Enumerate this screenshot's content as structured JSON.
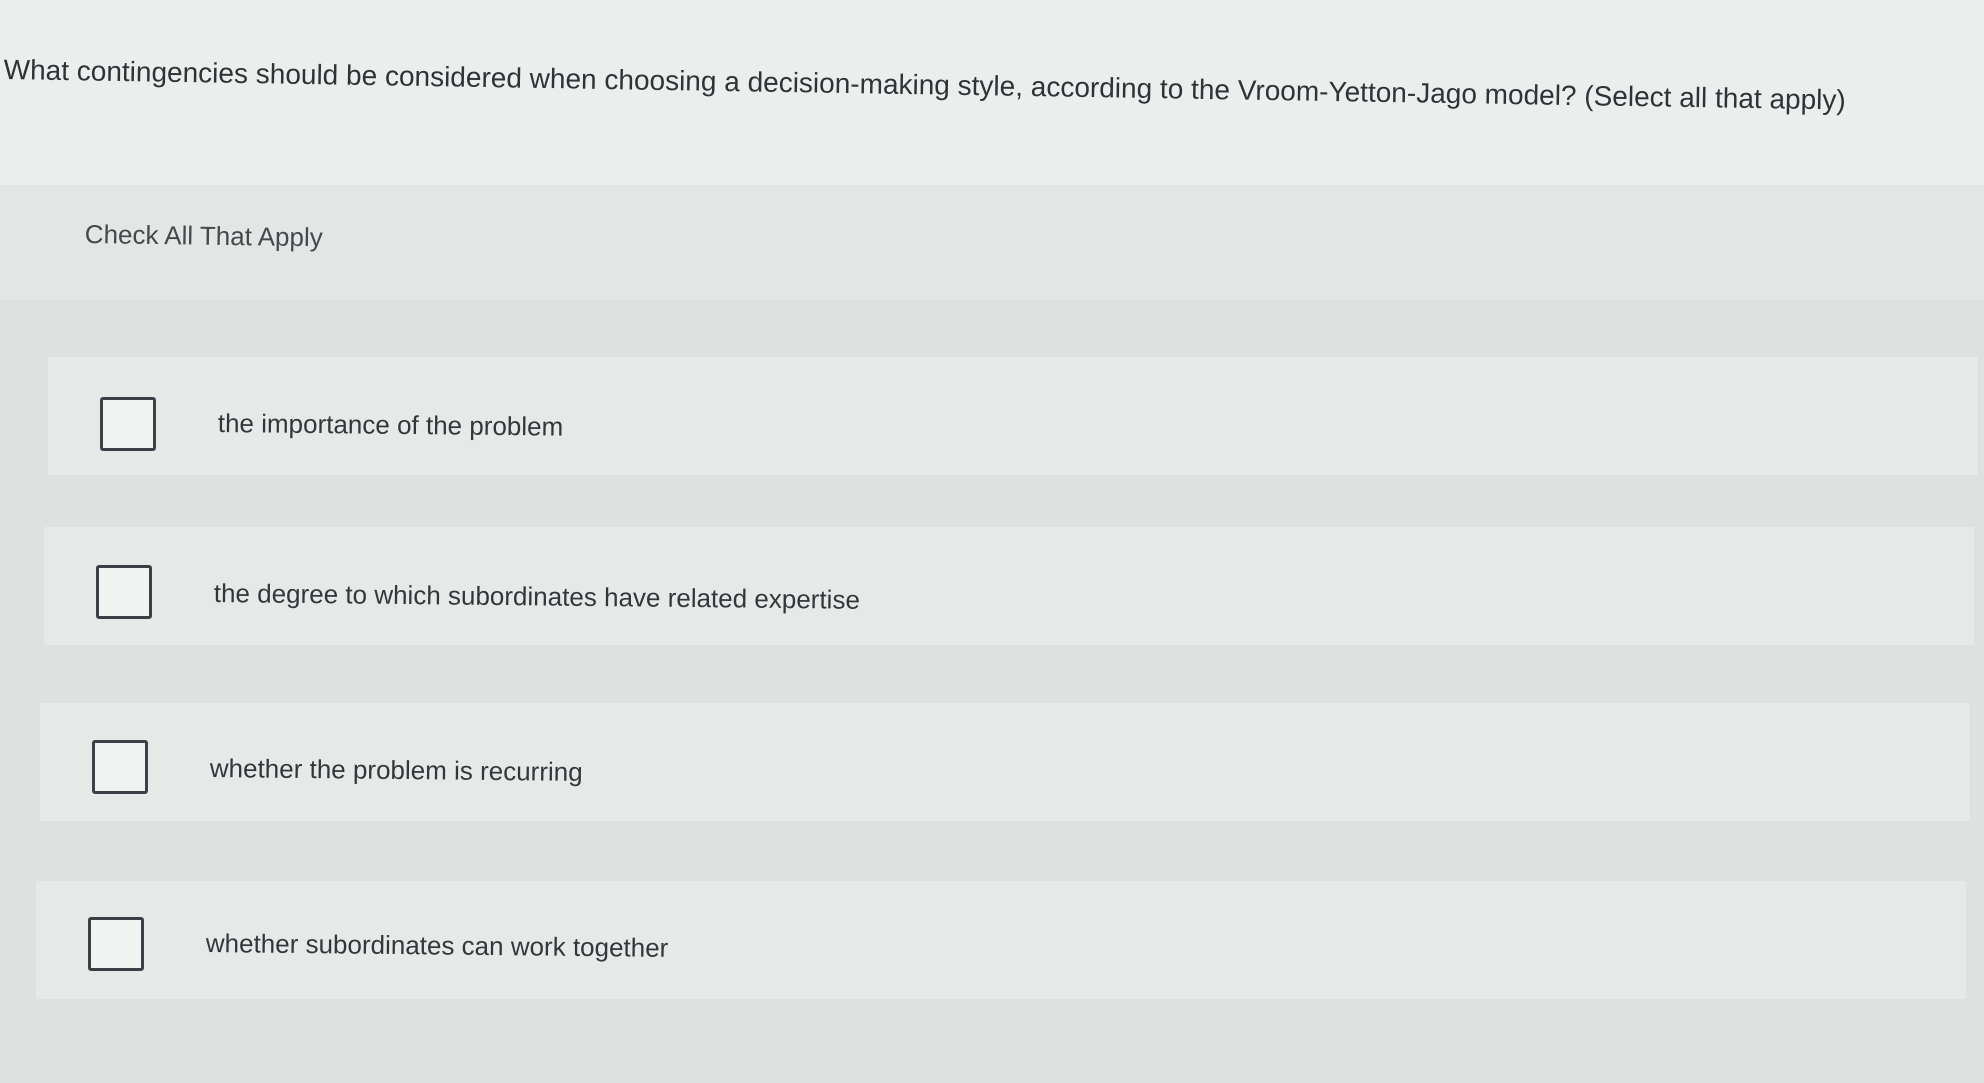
{
  "question": {
    "text": "What contingencies should be considered when choosing a decision-making style, according to the Vroom-Yetton-Jago model? (Select all that apply)"
  },
  "instructions": {
    "text": "Check All That Apply"
  },
  "options": [
    {
      "label": "the importance of the problem",
      "checked": false
    },
    {
      "label": "the degree to which subordinates have related expertise",
      "checked": false
    },
    {
      "label": "whether the problem is recurring",
      "checked": false
    },
    {
      "label": "whether subordinates can work together",
      "checked": false
    }
  ]
}
